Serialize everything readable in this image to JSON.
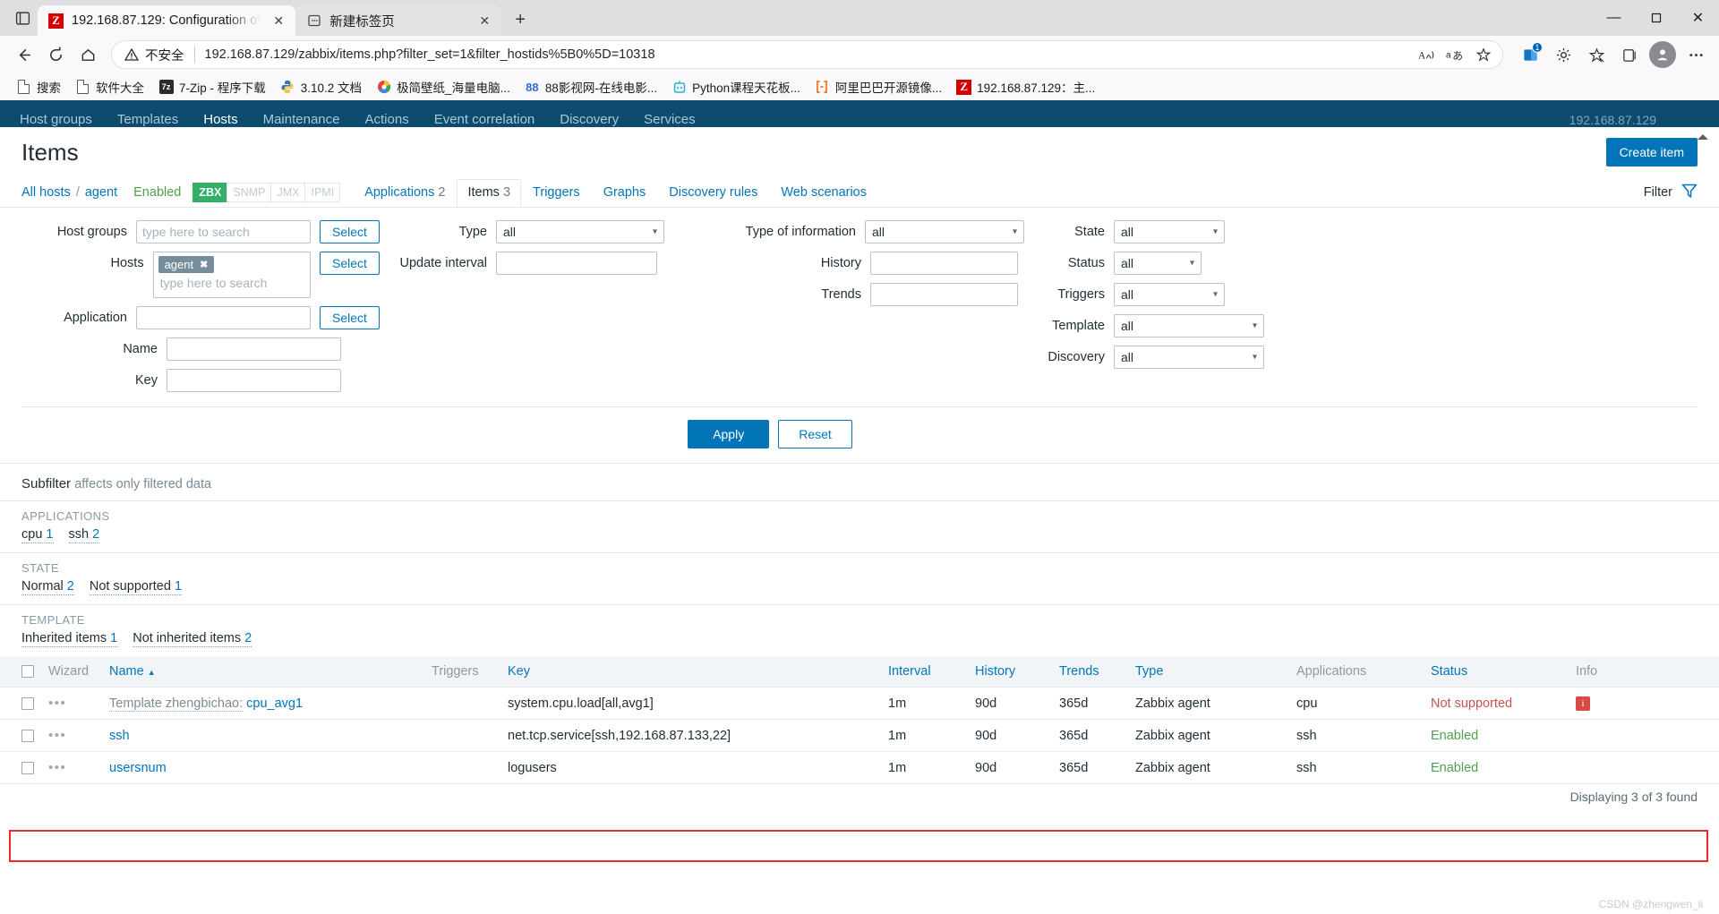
{
  "browser": {
    "tabs": [
      {
        "title": "192.168.87.129: Configuration of",
        "favicon": "zabbix-icon",
        "active": true,
        "close": "✕"
      },
      {
        "title": "新建标签页",
        "favicon": "newtab-page-icon",
        "active": false,
        "close": "✕"
      }
    ],
    "new_tab_label": "+",
    "window_controls": {
      "minimize": "—",
      "maximize": "☐",
      "close": "✕"
    },
    "nav": {
      "back": "←",
      "reload": "⟳",
      "home": "⌂"
    },
    "omnibox": {
      "security_label": "不安全",
      "url": "192.168.87.129/zabbix/items.php?filter_set=1&filter_hostids%5B0%5D=10318",
      "read_aloud_icon": "read-aloud-icon",
      "translate_icon": "translate-icon",
      "favorite_icon": "add-favorite-icon"
    },
    "toolbar_right": {
      "collections_badge": "1",
      "split_screen_icon": "split-screen-icon",
      "favorites_icon": "favorites-icon",
      "collections_icon": "collections-icon",
      "profile_icon": "profile-avatar-icon",
      "settings_icon": "more-options-icon"
    },
    "bookmarks": [
      {
        "label": "搜索",
        "icon": "page-icon"
      },
      {
        "label": "软件大全",
        "icon": "page-icon"
      },
      {
        "label": "7-Zip - 程序下载",
        "icon": "sevenzip-icon"
      },
      {
        "label": "3.10.2 文档",
        "icon": "python-icon"
      },
      {
        "label": "极简壁纸_海量电脑...",
        "icon": "color-wheel-icon"
      },
      {
        "label": "88影视网-在线电影...",
        "icon": "88-icon"
      },
      {
        "label": "Python课程天花板...",
        "icon": "robot-icon"
      },
      {
        "label": "阿里巴巴开源镜像...",
        "icon": "bracket-icon"
      },
      {
        "label": "192.168.87.129：主...",
        "icon": "zabbix-icon"
      }
    ]
  },
  "zabbix": {
    "nav_items": [
      {
        "label": "Host groups",
        "selected": false
      },
      {
        "label": "Templates",
        "selected": false
      },
      {
        "label": "Hosts",
        "selected": true
      },
      {
        "label": "Maintenance",
        "selected": false
      },
      {
        "label": "Actions",
        "selected": false
      },
      {
        "label": "Event correlation",
        "selected": false
      },
      {
        "label": "Discovery",
        "selected": false
      },
      {
        "label": "Services",
        "selected": false
      }
    ],
    "nav_host": "192.168.87.129",
    "page_title": "Items",
    "create_button": "Create item",
    "breadcrumb": {
      "all_hosts": "All hosts",
      "separator": "/",
      "host": "agent",
      "status": "Enabled",
      "protocols": [
        {
          "label": "ZBX",
          "active": true
        },
        {
          "label": "SNMP",
          "active": false
        },
        {
          "label": "JMX",
          "active": false
        },
        {
          "label": "IPMI",
          "active": false
        }
      ]
    },
    "sub_tabs": [
      {
        "label": "Applications",
        "count": "2",
        "active": false
      },
      {
        "label": "Items",
        "count": "3",
        "active": true
      },
      {
        "label": "Triggers",
        "count": "",
        "active": false
      },
      {
        "label": "Graphs",
        "count": "",
        "active": false
      },
      {
        "label": "Discovery rules",
        "count": "",
        "active": false
      },
      {
        "label": "Web scenarios",
        "count": "",
        "active": false
      }
    ],
    "filter_toggle": "Filter",
    "filter": {
      "col1": {
        "host_groups_label": "Host groups",
        "host_groups_placeholder": "type here to search",
        "host_groups_value": "",
        "host_groups_select": "Select",
        "hosts_label": "Hosts",
        "hosts_chip": "agent",
        "hosts_chip_remove": "✖",
        "hosts_placeholder": "type here to search",
        "hosts_select": "Select",
        "application_label": "Application",
        "application_value": "",
        "application_select": "Select",
        "name_label": "Name",
        "name_value": "",
        "key_label": "Key",
        "key_value": ""
      },
      "col2": {
        "type_label": "Type",
        "type_value": "all",
        "update_interval_label": "Update interval",
        "update_interval_value": ""
      },
      "col3": {
        "type_of_information_label": "Type of information",
        "type_of_information_value": "all",
        "history_label": "History",
        "history_value": "",
        "trends_label": "Trends",
        "trends_value": ""
      },
      "col4": {
        "state_label": "State",
        "state_value": "all",
        "status_label": "Status",
        "status_value": "all",
        "triggers_label": "Triggers",
        "triggers_value": "all",
        "template_label": "Template",
        "template_value": "all",
        "discovery_label": "Discovery",
        "discovery_value": "all"
      },
      "apply": "Apply",
      "reset": "Reset"
    },
    "subfilter": {
      "title": "Subfilter",
      "subtitle": "affects only filtered data",
      "groups": [
        {
          "title": "APPLICATIONS",
          "links": [
            {
              "label": "cpu",
              "count": "1"
            },
            {
              "label": "ssh",
              "count": "2"
            }
          ]
        },
        {
          "title": "STATE",
          "links": [
            {
              "label": "Normal",
              "count": "2"
            },
            {
              "label": "Not supported",
              "count": "1"
            }
          ]
        },
        {
          "title": "TEMPLATE",
          "links": [
            {
              "label": "Inherited items",
              "count": "1"
            },
            {
              "label": "Not inherited items",
              "count": "2"
            }
          ]
        }
      ]
    },
    "table": {
      "columns": [
        {
          "label": "",
          "key": "checkbox"
        },
        {
          "label": "Wizard",
          "key": "wizard",
          "dim": true
        },
        {
          "label": "Name",
          "key": "name",
          "sort": "▲"
        },
        {
          "label": "Triggers",
          "key": "triggers",
          "dim": true
        },
        {
          "label": "Key",
          "key": "key"
        },
        {
          "label": "Interval",
          "key": "interval"
        },
        {
          "label": "History",
          "key": "history"
        },
        {
          "label": "Trends",
          "key": "trends"
        },
        {
          "label": "Type",
          "key": "type"
        },
        {
          "label": "Applications",
          "key": "applications",
          "dim": true
        },
        {
          "label": "Status",
          "key": "status"
        },
        {
          "label": "Info",
          "key": "info",
          "dim": true
        }
      ],
      "rows": [
        {
          "wizard": "•••",
          "name_prefix": "Template zhengbichao:",
          "name": "cpu_avg1",
          "triggers": "",
          "key": "system.cpu.load[all,avg1]",
          "interval": "1m",
          "history": "90d",
          "trends": "365d",
          "type": "Zabbix agent",
          "applications": "cpu",
          "status": "Not supported",
          "status_style": "red",
          "info": "i",
          "highlighted": false
        },
        {
          "wizard": "•••",
          "name_prefix": "",
          "name": "ssh",
          "triggers": "",
          "key": "net.tcp.service[ssh,192.168.87.133,22]",
          "interval": "1m",
          "history": "90d",
          "trends": "365d",
          "type": "Zabbix agent",
          "applications": "ssh",
          "status": "Enabled",
          "status_style": "green",
          "info": "",
          "highlighted": false
        },
        {
          "wizard": "•••",
          "name_prefix": "",
          "name": "usersnum",
          "triggers": "",
          "key": "logusers",
          "interval": "1m",
          "history": "90d",
          "trends": "365d",
          "type": "Zabbix agent",
          "applications": "ssh",
          "status": "Enabled",
          "status_style": "green",
          "info": "",
          "highlighted": true
        }
      ],
      "footer": "Displaying 3 of 3 found"
    },
    "watermark": "CSDN @zhengwen_li",
    "colors": {
      "accent": "#0275b8",
      "nav_bg": "#0c4b6e",
      "enabled_green": "#4f9e4f",
      "not_supported_red": "#c5534c",
      "highlight_red": "#ef2929",
      "zbx_green": "#34af67"
    }
  }
}
